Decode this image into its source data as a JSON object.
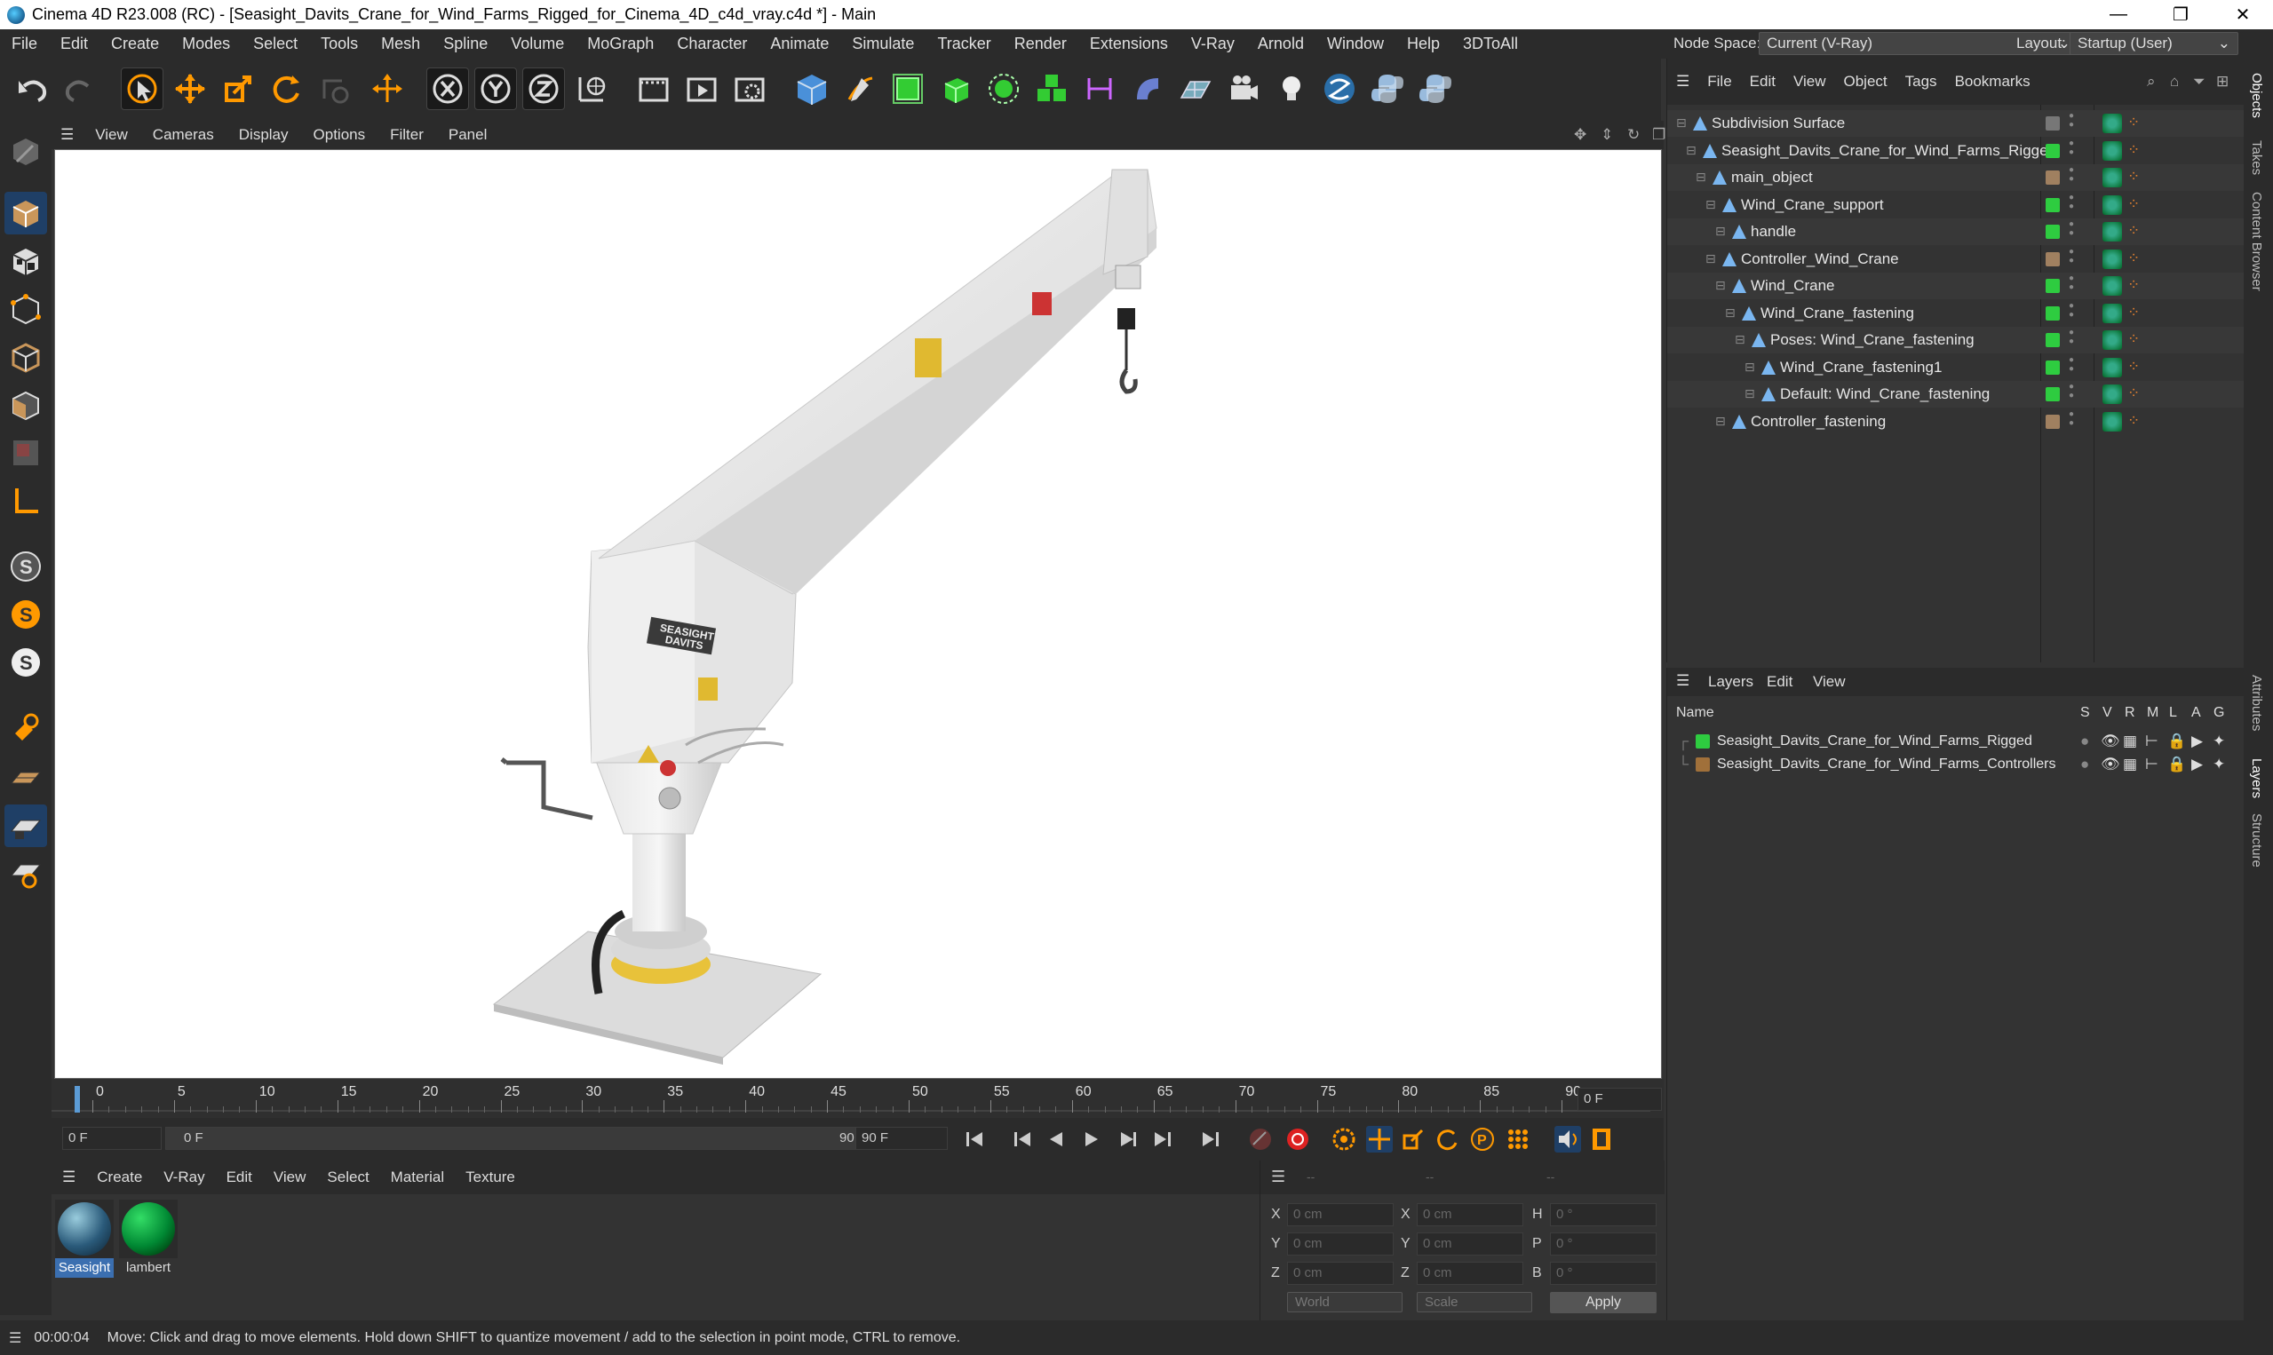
{
  "window": {
    "title": "Cinema 4D R23.008 (RC) - [Seasight_Davits_Crane_for_Wind_Farms_Rigged_for_Cinema_4D_c4d_vray.c4d *] - Main",
    "minimize": "—",
    "restore": "❐",
    "close": "✕"
  },
  "menubar": [
    "File",
    "Edit",
    "Create",
    "Modes",
    "Select",
    "Tools",
    "Mesh",
    "Spline",
    "Volume",
    "MoGraph",
    "Character",
    "Animate",
    "Simulate",
    "Tracker",
    "Render",
    "Extensions",
    "V-Ray",
    "Arnold",
    "Window",
    "Help",
    "3DToAll"
  ],
  "nodespace": {
    "label": "Node Space:",
    "value": "Current (V-Ray)",
    "layout_label": "Layout:",
    "layout_value": "Startup (User)"
  },
  "viewport_menu": [
    "View",
    "Cameras",
    "Display",
    "Options",
    "Filter",
    "Panel"
  ],
  "timeline": {
    "ticks": [
      "0",
      "5",
      "10",
      "15",
      "20",
      "25",
      "30",
      "35",
      "40",
      "45",
      "50",
      "55",
      "60",
      "65",
      "70",
      "75",
      "80",
      "85",
      "90"
    ],
    "current_frame": "0 F"
  },
  "transport": {
    "start": "0 F",
    "range_start": "0 F",
    "range_end": "90 F",
    "end": "90 F"
  },
  "material_menu": [
    "Create",
    "V-Ray",
    "Edit",
    "View",
    "Select",
    "Material",
    "Texture"
  ],
  "materials": [
    {
      "name": "Seasight",
      "selected": true
    },
    {
      "name": "lambert",
      "selected": false
    }
  ],
  "coords": {
    "headers": [
      "--",
      "--",
      "--"
    ],
    "rows": [
      {
        "a": "X",
        "v1": "0 cm",
        "b": "X",
        "v2": "0 cm",
        "c": "H",
        "v3": "0 °"
      },
      {
        "a": "Y",
        "v1": "0 cm",
        "b": "Y",
        "v2": "0 cm",
        "c": "P",
        "v3": "0 °"
      },
      {
        "a": "Z",
        "v1": "0 cm",
        "b": "Z",
        "v2": "0 cm",
        "c": "B",
        "v3": "0 °"
      }
    ],
    "world": "World",
    "scale": "Scale",
    "apply": "Apply"
  },
  "status": {
    "time": "00:00:04",
    "message": "Move: Click and drag to move elements. Hold down SHIFT to quantize movement / add to the selection in point mode, CTRL to remove."
  },
  "object_menu": [
    "File",
    "Edit",
    "View",
    "Object",
    "Tags",
    "Bookmarks"
  ],
  "objects": [
    {
      "name": "Subdivision Surface",
      "indent": 0,
      "color": "#777777"
    },
    {
      "name": "Seasight_Davits_Crane_for_Wind_Farms_Rigged",
      "indent": 1,
      "color": "#2ecc40"
    },
    {
      "name": "main_object",
      "indent": 2,
      "color": "#a08060"
    },
    {
      "name": "Wind_Crane_support",
      "indent": 3,
      "color": "#2ecc40"
    },
    {
      "name": "handle",
      "indent": 4,
      "color": "#2ecc40"
    },
    {
      "name": "Controller_Wind_Crane",
      "indent": 3,
      "color": "#a08060"
    },
    {
      "name": "Wind_Crane",
      "indent": 4,
      "color": "#2ecc40"
    },
    {
      "name": "Wind_Crane_fastening",
      "indent": 5,
      "color": "#2ecc40"
    },
    {
      "name": "Poses: Wind_Crane_fastening",
      "indent": 6,
      "color": "#2ecc40"
    },
    {
      "name": "Wind_Crane_fastening1",
      "indent": 7,
      "color": "#2ecc40"
    },
    {
      "name": "Default: Wind_Crane_fastening",
      "indent": 7,
      "color": "#2ecc40"
    },
    {
      "name": "Controller_fastening",
      "indent": 4,
      "color": "#a08060"
    }
  ],
  "layer_menu": [
    "Layers",
    "Edit",
    "View"
  ],
  "layer_header": {
    "name": "Name",
    "cols": [
      "S",
      "V",
      "R",
      "M",
      "L",
      "A",
      "G"
    ]
  },
  "layers": [
    {
      "name": "Seasight_Davits_Crane_for_Wind_Farms_Rigged",
      "color": "#2ecc40"
    },
    {
      "name": "Seasight_Davits_Crane_for_Wind_Farms_Controllers",
      "color": "#a0703a"
    }
  ],
  "side_tabs": [
    "Objects",
    "Takes",
    "Content Browser",
    "Attributes",
    "Layers",
    "Structure"
  ],
  "crane_labels": {
    "brand_line1": "SEASIGHT",
    "brand_line2": "DAVITS"
  }
}
